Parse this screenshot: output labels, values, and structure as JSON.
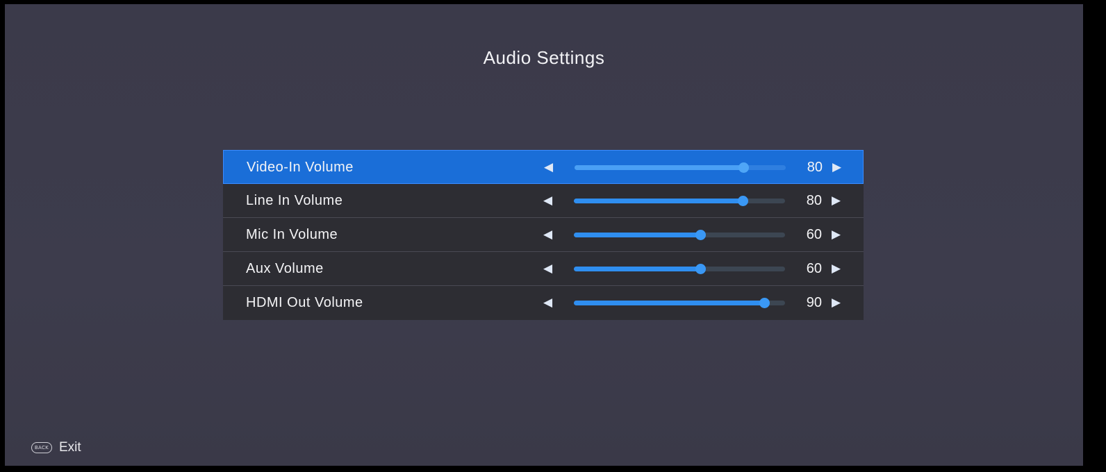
{
  "title": "Audio Settings",
  "menu": {
    "items": [
      {
        "label": "Video-In Volume",
        "value": "80",
        "level": 0.8,
        "selected": true
      },
      {
        "label": "Line In Volume",
        "value": "80",
        "level": 0.8,
        "selected": false
      },
      {
        "label": "Mic In Volume",
        "value": "60",
        "level": 0.6,
        "selected": false
      },
      {
        "label": "Aux Volume",
        "value": "60",
        "level": 0.6,
        "selected": false
      },
      {
        "label": "HDMI Out Volume",
        "value": "90",
        "level": 0.9,
        "selected": false
      }
    ],
    "left_arrow_icon": "triangle-left-icon",
    "right_arrow_icon": "triangle-right-icon"
  },
  "footer": {
    "back_button_label": "BACK",
    "exit_label": "Exit"
  },
  "colors": {
    "accent": "#1a6ed8",
    "slider_fill": "#2f8ef0",
    "background": "#3b3a4a"
  }
}
